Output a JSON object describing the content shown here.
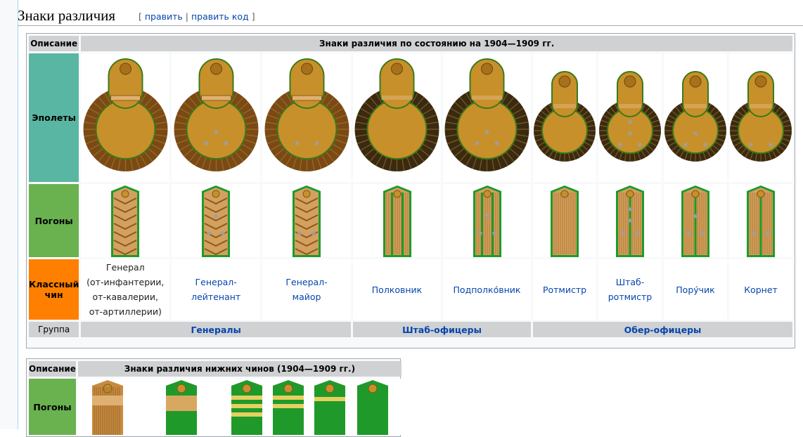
{
  "section": {
    "title": "Знаки различия",
    "edit_open": "[",
    "edit": "править",
    "sep": "|",
    "edit_code": "править код",
    "edit_close": "]"
  },
  "table1": {
    "desc_header": "Описание",
    "main_header": "Знаки различия по состоянию на 1904—1909 гг.",
    "row_epaulettes": "Эполеты",
    "row_pogony": "Погоны",
    "row_class_line1": "Классный",
    "row_class_line2": "чин",
    "row_group": "Группа",
    "ranks": [
      {
        "lines": [
          "Генерал",
          "(от-инфантерии,",
          "от-кавалерии,",
          "от-артиллерии)"
        ],
        "link": false
      },
      {
        "lines": [
          "Генерал-",
          "лейтенант"
        ],
        "link": true
      },
      {
        "lines": [
          "Генерал-",
          "майор"
        ],
        "link": true
      },
      {
        "lines": [
          "Полковник"
        ],
        "link": true
      },
      {
        "lines": [
          "Подполко́вник"
        ],
        "link": true
      },
      {
        "lines": [
          "Ротмистр"
        ],
        "link": true
      },
      {
        "lines": [
          "Штаб-",
          "ротмистр"
        ],
        "link": true
      },
      {
        "lines": [
          "Пору́чик"
        ],
        "link": true
      },
      {
        "lines": [
          "Корнет"
        ],
        "link": true
      }
    ],
    "groups": [
      "Генералы",
      "Штаб-офицеры",
      "Обер-офицеры"
    ]
  },
  "table2": {
    "desc_header": "Описание",
    "main_header": "Знаки различия нижних чинов (1904—1909 гг.)",
    "row_pogony": "Погоны"
  },
  "colors": {
    "gold": "#c8902a",
    "green": "#1f9a2a",
    "fringe": "#7a4a15"
  },
  "epaulettes": [
    {
      "type": "general",
      "stars": 0
    },
    {
      "type": "general",
      "stars": 3
    },
    {
      "type": "general",
      "stars": 2
    },
    {
      "type": "staff",
      "stars": 0
    },
    {
      "type": "staff",
      "stars": 3
    },
    {
      "type": "ober",
      "stars": 0
    },
    {
      "type": "ober",
      "stars": 4
    },
    {
      "type": "ober",
      "stars": 3
    },
    {
      "type": "ober",
      "stars": 2
    }
  ],
  "shoulder_boards": [
    {
      "type": "general",
      "stars": 0
    },
    {
      "type": "general",
      "stars": 3
    },
    {
      "type": "general",
      "stars": 2
    },
    {
      "type": "staff",
      "stars": 0
    },
    {
      "type": "staff",
      "stars": 3
    },
    {
      "type": "ober",
      "stars": 0
    },
    {
      "type": "ober",
      "stars": 4
    },
    {
      "type": "ober",
      "stars": 3
    },
    {
      "type": "ober",
      "stars": 2
    }
  ]
}
